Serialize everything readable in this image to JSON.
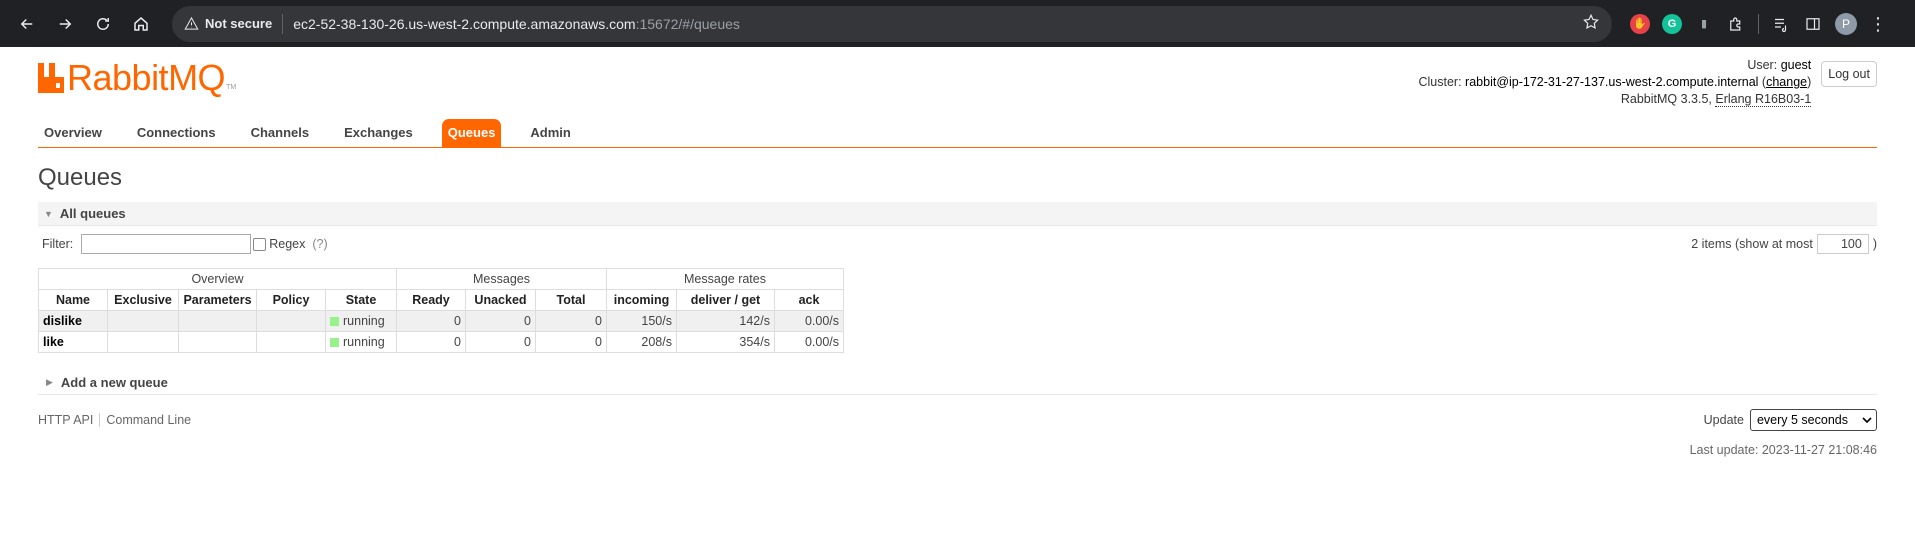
{
  "browser": {
    "not_secure": "Not secure",
    "url_host": "ec2-52-38-130-26.us-west-2.compute.amazonaws.com",
    "url_rest": ":15672/#/queues",
    "profile_initial": "P"
  },
  "header": {
    "logo_text": "RabbitMQ",
    "logo_tm": "TM",
    "user_label": "User:",
    "user": "guest",
    "cluster_label": "Cluster:",
    "cluster": "rabbit@ip-172-31-27-137.us-west-2.compute.internal",
    "change": "change",
    "version": "RabbitMQ 3.3.5,",
    "erlang": "Erlang R16B03-1",
    "logout": "Log out"
  },
  "tabs": [
    {
      "label": "Overview"
    },
    {
      "label": "Connections"
    },
    {
      "label": "Channels"
    },
    {
      "label": "Exchanges"
    },
    {
      "label": "Queues"
    },
    {
      "label": "Admin"
    }
  ],
  "title": "Queues",
  "all_queues": {
    "label": "All queues",
    "filter_label": "Filter:",
    "filter_value": "",
    "regex_label": "Regex",
    "regex_hint": "(?)",
    "items_text": "2 items (show at most",
    "items_max": "100",
    "items_close": ")"
  },
  "table": {
    "groups": [
      "Overview",
      "Messages",
      "Message rates"
    ],
    "columns": [
      "Name",
      "Exclusive",
      "Parameters",
      "Policy",
      "State",
      "Ready",
      "Unacked",
      "Total",
      "incoming",
      "deliver / get",
      "ack"
    ],
    "rows": [
      {
        "name": "dislike",
        "exclusive": "",
        "parameters": "",
        "policy": "",
        "state": "running",
        "ready": "0",
        "unacked": "0",
        "total": "0",
        "incoming": "150/s",
        "deliver": "142/s",
        "ack": "0.00/s"
      },
      {
        "name": "like",
        "exclusive": "",
        "parameters": "",
        "policy": "",
        "state": "running",
        "ready": "0",
        "unacked": "0",
        "total": "0",
        "incoming": "208/s",
        "deliver": "354/s",
        "ack": "0.00/s"
      }
    ]
  },
  "add_queue": "Add a new queue",
  "footer": {
    "http_api": "HTTP API",
    "command_line": "Command Line",
    "update_label": "Update",
    "update_value": "every 5 seconds",
    "last_update": "Last update: 2023-11-27 21:08:46"
  },
  "colors": {
    "brand": "#ff6600",
    "running": "#98f28c"
  }
}
